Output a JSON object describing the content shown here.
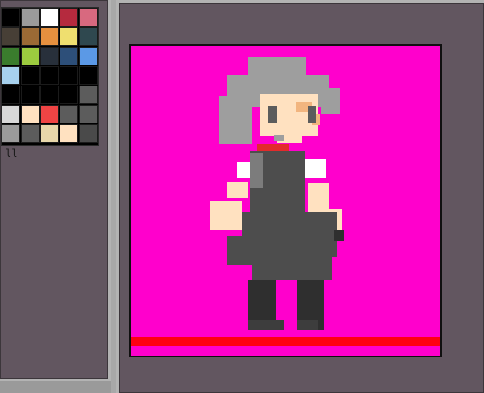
{
  "palette": {
    "colors": [
      "#000000",
      "#9b9b9b",
      "#ffffff",
      "#b52a3e",
      "#d8697f",
      "#473f36",
      "#9b6a35",
      "#e6903f",
      "#efdf6f",
      "#2f484f",
      "#3a7c2d",
      "#9ccb3f",
      "#28303b",
      "#2d4f79",
      "#5b99e6",
      "#a7d1ee",
      "#000000",
      "#000000",
      "#000000",
      "#000000",
      "#000000",
      "#000000",
      "#000000",
      "#000000",
      "#5c5c5c",
      "#d8d8d8",
      "#ffe1c0",
      "#ef4444",
      "#5c5c5c",
      "#5c5c5c",
      "#9b9b9b",
      "#5c5c5c",
      "#e8d7aa",
      "#ffe1c0",
      "#4a4a4a"
    ],
    "selected_index": 0,
    "label": "ll"
  },
  "canvas": {
    "background": "#ff00cc",
    "floor_color": "#ff0011"
  }
}
